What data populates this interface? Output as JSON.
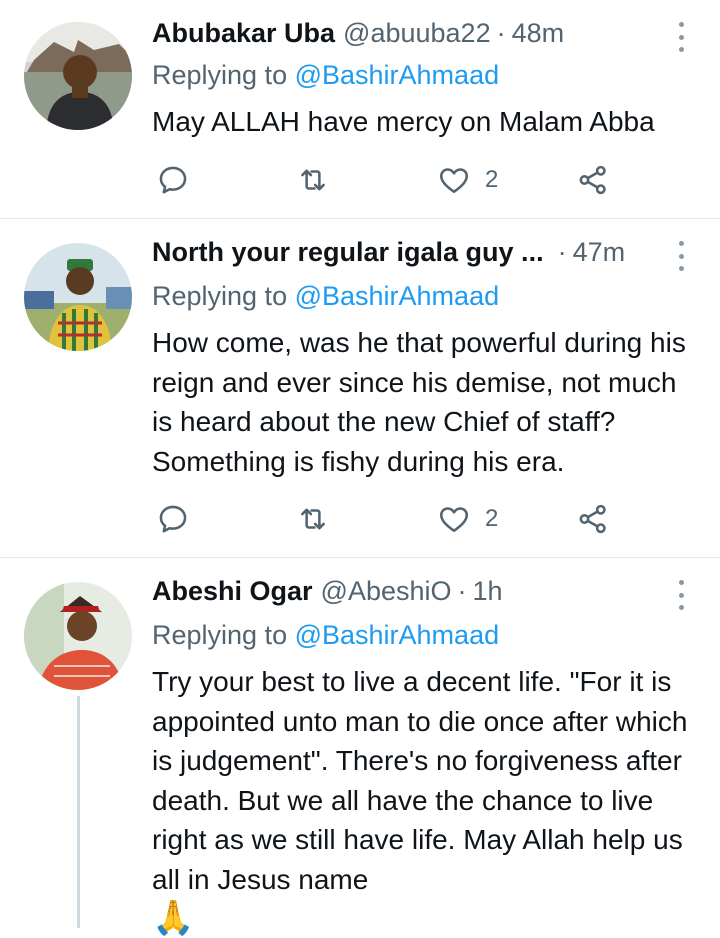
{
  "tweets": [
    {
      "name": "Abubakar Uba",
      "handle": "@abuuba22",
      "separator": "·",
      "time": "48m",
      "replying_prefix": "Replying to ",
      "replying_to": "@BashirAhmaad",
      "body": "May ALLAH have mercy on Malam Abba",
      "like_count": "2"
    },
    {
      "name": "North your regular igala guy ...",
      "handle": "",
      "separator": "·",
      "time": "47m",
      "replying_prefix": "Replying to ",
      "replying_to": "@BashirAhmaad",
      "body": "How come, was he that powerful during his reign and ever since his demise, not much is heard about the new Chief of staff? Something is fishy during his era.",
      "like_count": "2"
    },
    {
      "name": "Abeshi Ogar",
      "handle": "@AbeshiO",
      "separator": "·",
      "time": "1h",
      "replying_prefix": "Replying to ",
      "replying_to": "@BashirAhmaad",
      "body": "Try your best to live a decent life. \"For it is appointed unto man to die once after which is judgement\". There's no forgiveness after death. But we all have the chance to live right as we still have life. May Allah help us all in Jesus name",
      "emoji": "🙏"
    }
  ],
  "icons": {
    "reply": "reply-icon",
    "retweet": "retweet-icon",
    "like": "heart-icon",
    "share": "share-icon",
    "more": "more-options-icon"
  },
  "colors": {
    "link": "#1d9bf0",
    "secondary": "#536471",
    "icon": "#536471"
  }
}
